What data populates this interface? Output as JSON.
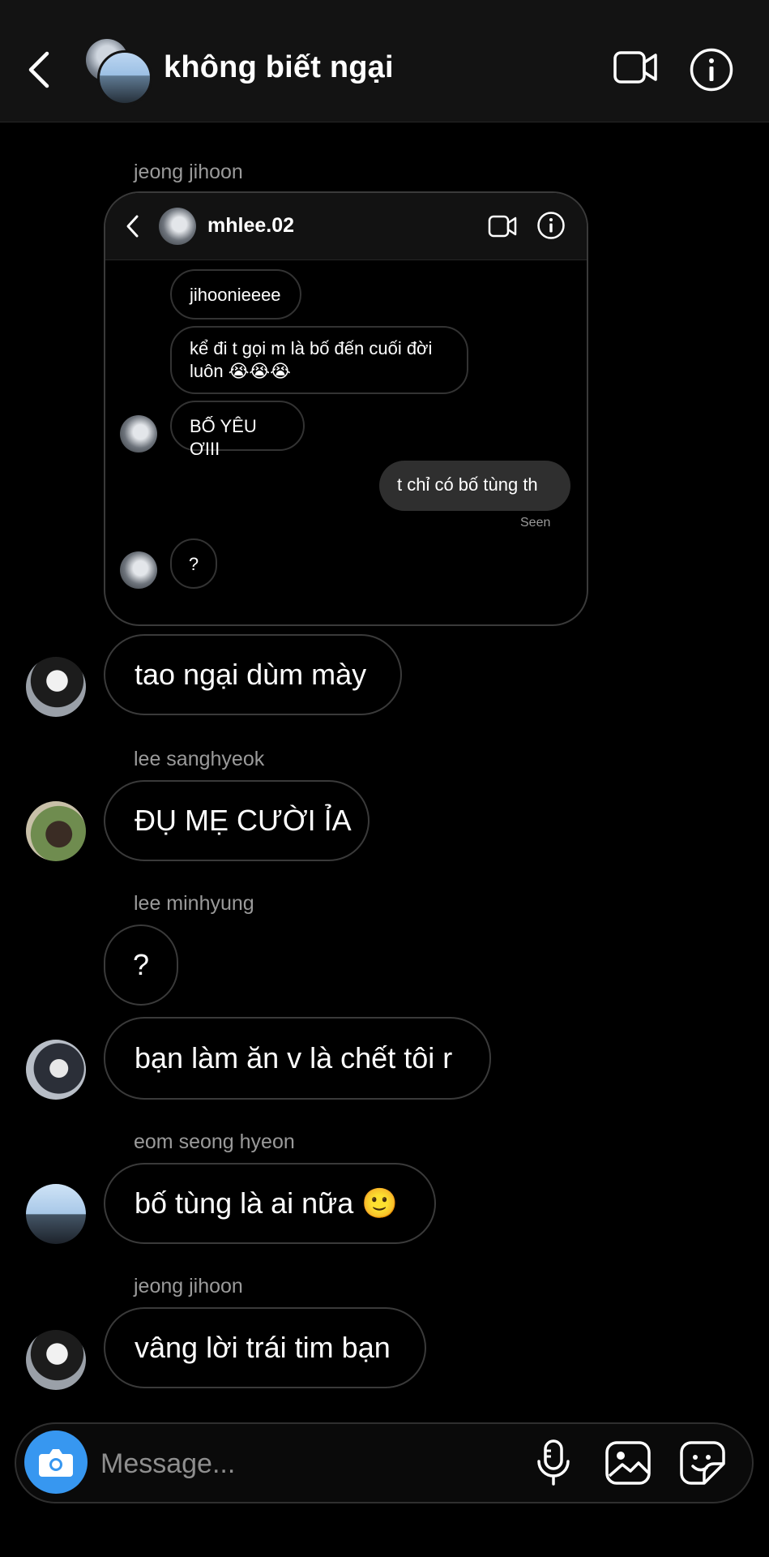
{
  "header": {
    "title": "không biết ngại"
  },
  "shared_post": {
    "sender": "jeong jihoon",
    "username": "mhlee.02",
    "messages": [
      {
        "text": "jihoonieeee"
      },
      {
        "text": "kể đi t gọi m là bố đến cuối đời luôn 😭😭😭"
      },
      {
        "text": "BỐ YÊU ƠIII"
      },
      {
        "text": "t chỉ có bố tùng th"
      },
      {
        "text": "?"
      }
    ],
    "seen": "Seen"
  },
  "chat": [
    {
      "text": "tao ngại dùm mày"
    },
    {
      "sender": "lee sanghyeok",
      "text": "ĐỤ MẸ CƯỜI ỈA"
    },
    {
      "sender": "lee minhyung",
      "text": "?"
    },
    {
      "text": "bạn làm ăn v là chết tôi r"
    },
    {
      "sender": "eom seong hyeon",
      "text": "bố tùng là ai nữa 🙂"
    },
    {
      "sender": "jeong jihoon",
      "text": "vâng lời trái tim bạn"
    }
  ],
  "composer": {
    "placeholder": "Message..."
  },
  "icons": {
    "back": "back-arrow-icon",
    "video": "video-call-icon",
    "info": "info-icon",
    "camera": "camera-icon",
    "mic": "microphone-icon",
    "gallery": "gallery-icon",
    "sticker": "sticker-icon"
  },
  "colors": {
    "accent": "#3797f0",
    "background": "#000000",
    "header": "#131313"
  }
}
